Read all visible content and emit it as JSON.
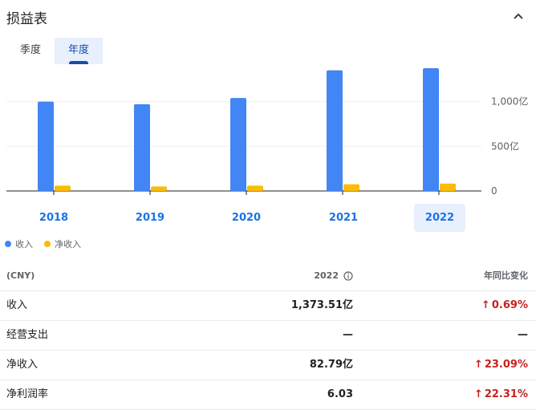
{
  "header": {
    "title": "损益表"
  },
  "tabs": [
    {
      "label": "季度"
    },
    {
      "label": "年度"
    }
  ],
  "years": [
    "2018",
    "2019",
    "2020",
    "2021",
    "2022"
  ],
  "selected_year": "2022",
  "legend": {
    "revenue": "收入",
    "net_income": "净收入"
  },
  "colors": {
    "revenue": "#4285f4",
    "net_income": "#fbbc04",
    "negative": "#c5221f",
    "accent": "#1a73e8"
  },
  "chart_data": {
    "type": "bar",
    "categories": [
      "2018",
      "2019",
      "2020",
      "2021",
      "2022"
    ],
    "series": [
      {
        "name": "收入",
        "values": [
          1000,
          970,
          1040,
          1350,
          1373.51
        ]
      },
      {
        "name": "净收入",
        "values": [
          60,
          50,
          60,
          75,
          82.79
        ]
      }
    ],
    "ylim": [
      0,
      1400
    ],
    "yticks": [
      {
        "value": 0,
        "label": "0"
      },
      {
        "value": 500,
        "label": "500亿"
      },
      {
        "value": 1000,
        "label": "1,000亿"
      }
    ]
  },
  "table": {
    "header": {
      "col1": "(CNY)",
      "col2": "2022",
      "col3": "年同比变化"
    },
    "rows": [
      {
        "label": "收入",
        "value": "1,373.51亿",
        "change": "0.69%",
        "arrow": "↑"
      },
      {
        "label": "经营支出",
        "value": "—",
        "change": "—",
        "arrow": ""
      },
      {
        "label": "净收入",
        "value": "82.79亿",
        "change": "23.09%",
        "arrow": "↑"
      },
      {
        "label": "净利润率",
        "value": "6.03",
        "change": "22.31%",
        "arrow": "↑"
      }
    ]
  }
}
